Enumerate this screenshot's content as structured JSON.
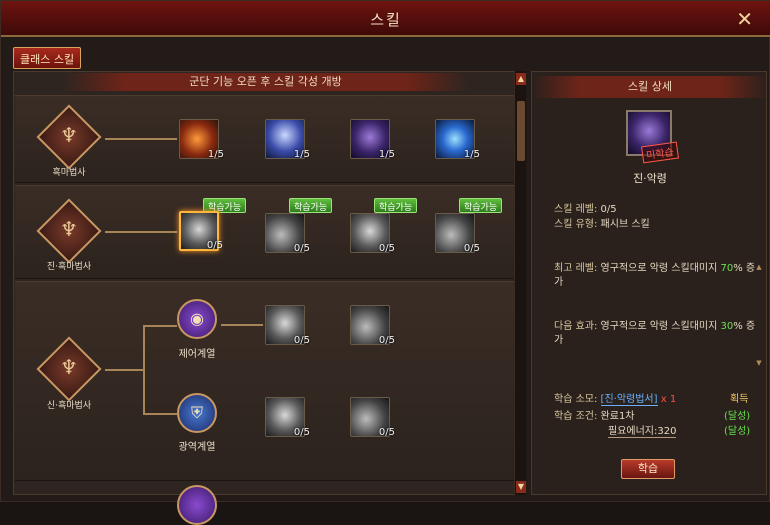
{
  "window": {
    "title": "스킬",
    "close_glyph": "✕"
  },
  "tab": {
    "label": "클래스 스킬"
  },
  "banner": "군단 기능 오픈 후 스킬 각성 개방",
  "tree": {
    "rows": [
      {
        "class_name": "흑마법사",
        "skills": [
          {
            "icon": "fire-orb-icon",
            "level": "1/5"
          },
          {
            "icon": "tornado-icon",
            "level": "1/5"
          },
          {
            "icon": "dragon-icon",
            "level": "1/5"
          },
          {
            "icon": "lightning-orb-icon",
            "level": "1/5"
          }
        ]
      },
      {
        "class_name": "진·흑마법사",
        "skills": [
          {
            "icon": "dark-spirit-icon",
            "level": "0/5",
            "badge": "학습가능"
          },
          {
            "icon": "wolf-icon",
            "level": "0/5",
            "badge": "학습가능"
          },
          {
            "icon": "flame-icon",
            "level": "0/5",
            "badge": "학습가능"
          },
          {
            "icon": "claw-icon",
            "level": "0/5",
            "badge": "학습가능"
          }
        ]
      },
      {
        "class_name": "신·흑마법사",
        "branches": [
          {
            "name": "제어계열",
            "skills": [
              {
                "icon": "wing-icon",
                "level": "0/5"
              },
              {
                "icon": "beast-icon",
                "level": "0/5"
              }
            ]
          },
          {
            "name": "광역계열",
            "skills": [
              {
                "icon": "dragon-head-icon",
                "level": "0/5"
              },
              {
                "icon": "crescent-icon",
                "level": "0/5"
              }
            ]
          }
        ]
      }
    ]
  },
  "detail": {
    "title": "스킬 상세",
    "stamp": "미학습",
    "skill_name": "진·악령",
    "level_label": "스킬 레벨:",
    "level_value": "0/5",
    "type_label": "스킬 유형:",
    "type_value": "패시브 스킬",
    "max_label": "최고 레벨:",
    "max_text": "영구적으로 악령 스킬대미지",
    "max_value": "70",
    "max_suffix": "% 증가",
    "next_label": "다음 효과:",
    "next_text": "영구적으로 악령 스킬대미지",
    "next_value": "30",
    "next_suffix": "% 증가",
    "cost_label": "학습 소모:",
    "cost_item": "[진·악령법서]",
    "cost_qty": "x 1",
    "cost_status": "획득",
    "cond_label": "학습 조건:",
    "cond_1": "완료1차",
    "cond_1_status": "(달성)",
    "cond_2": "필요에너지:320",
    "cond_2_status": "(달성)",
    "learn_button": "학습"
  },
  "colors": {
    "accent": "#8c1c14",
    "learnable": "#3fa02a",
    "achieved": "#6be050"
  }
}
